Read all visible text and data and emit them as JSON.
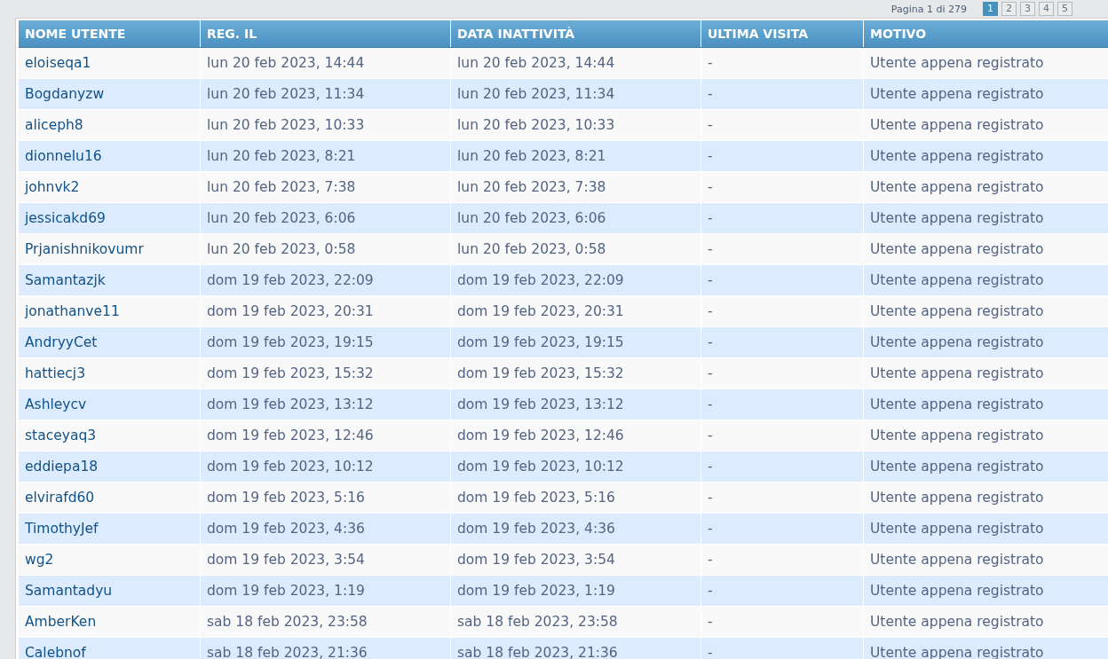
{
  "pagination": {
    "label": "Pagina 1 di 279",
    "pages": [
      {
        "label": "1",
        "selected": true
      },
      {
        "label": "2",
        "selected": false
      },
      {
        "label": "3",
        "selected": false
      },
      {
        "label": "4",
        "selected": false
      },
      {
        "label": "5",
        "selected": false
      }
    ]
  },
  "table": {
    "columns": [
      "NOME UTENTE",
      "REG. IL",
      "DATA INATTIVITÀ",
      "ULTIMA VISITA",
      "MOTIVO"
    ],
    "rows": [
      [
        "eloiseqa1",
        "lun 20 feb 2023, 14:44",
        "lun 20 feb 2023, 14:44",
        "-",
        "Utente appena registrato"
      ],
      [
        "Bogdanyzw",
        "lun 20 feb 2023, 11:34",
        "lun 20 feb 2023, 11:34",
        "-",
        "Utente appena registrato"
      ],
      [
        "aliceph8",
        "lun 20 feb 2023, 10:33",
        "lun 20 feb 2023, 10:33",
        "-",
        "Utente appena registrato"
      ],
      [
        "dionnelu16",
        "lun 20 feb 2023, 8:21",
        "lun 20 feb 2023, 8:21",
        "-",
        "Utente appena registrato"
      ],
      [
        "johnvk2",
        "lun 20 feb 2023, 7:38",
        "lun 20 feb 2023, 7:38",
        "-",
        "Utente appena registrato"
      ],
      [
        "jessicakd69",
        "lun 20 feb 2023, 6:06",
        "lun 20 feb 2023, 6:06",
        "-",
        "Utente appena registrato"
      ],
      [
        "Prjanishnikovumr",
        "lun 20 feb 2023, 0:58",
        "lun 20 feb 2023, 0:58",
        "-",
        "Utente appena registrato"
      ],
      [
        "Samantazjk",
        "dom 19 feb 2023, 22:09",
        "dom 19 feb 2023, 22:09",
        "-",
        "Utente appena registrato"
      ],
      [
        "jonathanve11",
        "dom 19 feb 2023, 20:31",
        "dom 19 feb 2023, 20:31",
        "-",
        "Utente appena registrato"
      ],
      [
        "AndryyCet",
        "dom 19 feb 2023, 19:15",
        "dom 19 feb 2023, 19:15",
        "-",
        "Utente appena registrato"
      ],
      [
        "hattiecj3",
        "dom 19 feb 2023, 15:32",
        "dom 19 feb 2023, 15:32",
        "-",
        "Utente appena registrato"
      ],
      [
        "Ashleycv",
        "dom 19 feb 2023, 13:12",
        "dom 19 feb 2023, 13:12",
        "-",
        "Utente appena registrato"
      ],
      [
        "staceyaq3",
        "dom 19 feb 2023, 12:46",
        "dom 19 feb 2023, 12:46",
        "-",
        "Utente appena registrato"
      ],
      [
        "eddiepa18",
        "dom 19 feb 2023, 10:12",
        "dom 19 feb 2023, 10:12",
        "-",
        "Utente appena registrato"
      ],
      [
        "elvirafd60",
        "dom 19 feb 2023, 5:16",
        "dom 19 feb 2023, 5:16",
        "-",
        "Utente appena registrato"
      ],
      [
        "TimothyJef",
        "dom 19 feb 2023, 4:36",
        "dom 19 feb 2023, 4:36",
        "-",
        "Utente appena registrato"
      ],
      [
        "wg2",
        "dom 19 feb 2023, 3:54",
        "dom 19 feb 2023, 3:54",
        "-",
        "Utente appena registrato"
      ],
      [
        "Samantadyu",
        "dom 19 feb 2023, 1:19",
        "dom 19 feb 2023, 1:19",
        "-",
        "Utente appena registrato"
      ],
      [
        "AmberKen",
        "sab 18 feb 2023, 23:58",
        "sab 18 feb 2023, 23:58",
        "-",
        "Utente appena registrato"
      ],
      [
        "Calebnof",
        "sab 18 feb 2023, 21:36",
        "sab 18 feb 2023, 21:36",
        "-",
        "Utente appena registrato"
      ]
    ]
  }
}
